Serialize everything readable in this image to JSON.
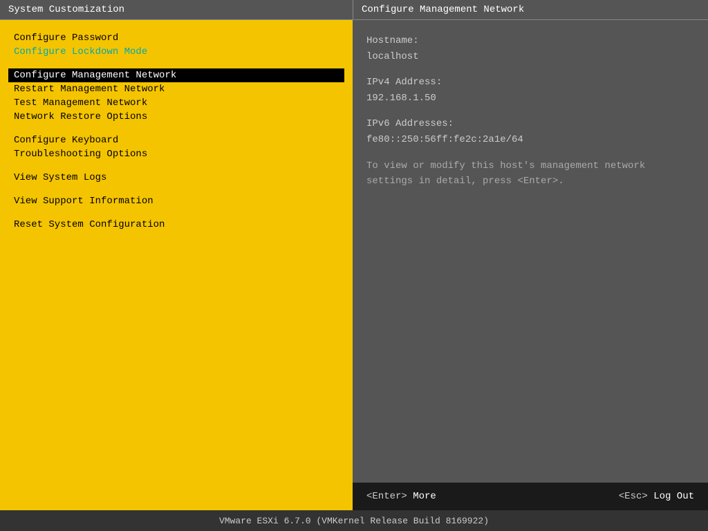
{
  "left_panel": {
    "header": "System Customization",
    "menu_items": [
      {
        "label": "Configure Password",
        "type": "normal",
        "selected": false
      },
      {
        "label": "Configure Lockdown Mode",
        "type": "cyan",
        "selected": false
      },
      {
        "label": "Configure Management Network",
        "type": "normal",
        "selected": true
      },
      {
        "label": "Restart Management Network",
        "type": "normal",
        "selected": false
      },
      {
        "label": "Test Management Network",
        "type": "normal",
        "selected": false
      },
      {
        "label": "Network Restore Options",
        "type": "normal",
        "selected": false
      },
      {
        "label": "Configure Keyboard",
        "type": "normal",
        "selected": false
      },
      {
        "label": "Troubleshooting Options",
        "type": "normal",
        "selected": false
      },
      {
        "label": "View System Logs",
        "type": "normal",
        "selected": false
      },
      {
        "label": "View Support Information",
        "type": "normal",
        "selected": false
      },
      {
        "label": "Reset System Configuration",
        "type": "normal",
        "selected": false
      }
    ]
  },
  "right_panel": {
    "header": "Configure Management Network",
    "hostname_label": "Hostname:",
    "hostname_value": "localhost",
    "ipv4_label": "IPv4 Address:",
    "ipv4_value": "192.168.1.50",
    "ipv6_label": "IPv6 Addresses:",
    "ipv6_value": "fe80::250:56ff:fe2c:2a1e/64",
    "description": "To view or modify this host's management network settings in detail, press <Enter>."
  },
  "bottom_bar": {
    "enter_label": "<Enter>",
    "enter_action": "More",
    "esc_label": "<Esc>",
    "esc_action": "Log Out"
  },
  "footer": {
    "text": "VMware ESXi 6.7.0 (VMKernel Release Build 8169922)"
  }
}
